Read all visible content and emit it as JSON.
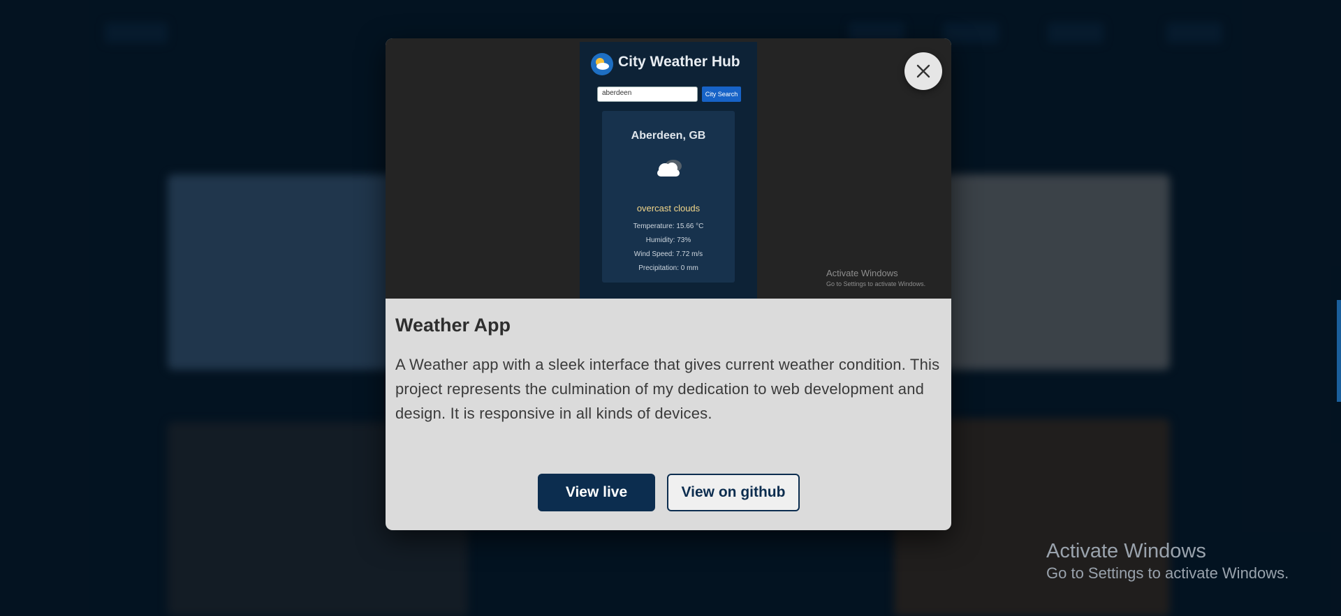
{
  "modal": {
    "title": "Weather App",
    "description": "A Weather app with a sleek interface that gives current weather condition. This project represents the culmination of my dedication to web development and design. It is responsive in all kinds of devices.",
    "buttons": {
      "live": "View live",
      "github": "View on github"
    },
    "close_icon": "close-icon"
  },
  "preview": {
    "app_title": "City Weather Hub",
    "search_value": "aberdeen",
    "search_button": "City Search",
    "city": "Aberdeen, GB",
    "condition": "overcast clouds",
    "temperature": "Temperature: 15.66 °C",
    "humidity": "Humidity: 73%",
    "wind": "Wind Speed: 7.72 m/s",
    "precipitation": "Precipitation: 0 mm",
    "watermark_title": "Activate Windows",
    "watermark_sub": "Go to Settings to activate Windows."
  },
  "os_watermark": {
    "title": "Activate Windows",
    "subtitle": "Go to Settings to activate Windows."
  },
  "colors": {
    "page_bg": "#051a2c",
    "primary": "#0c2d4f",
    "modal_bg": "#dbdbdb"
  }
}
